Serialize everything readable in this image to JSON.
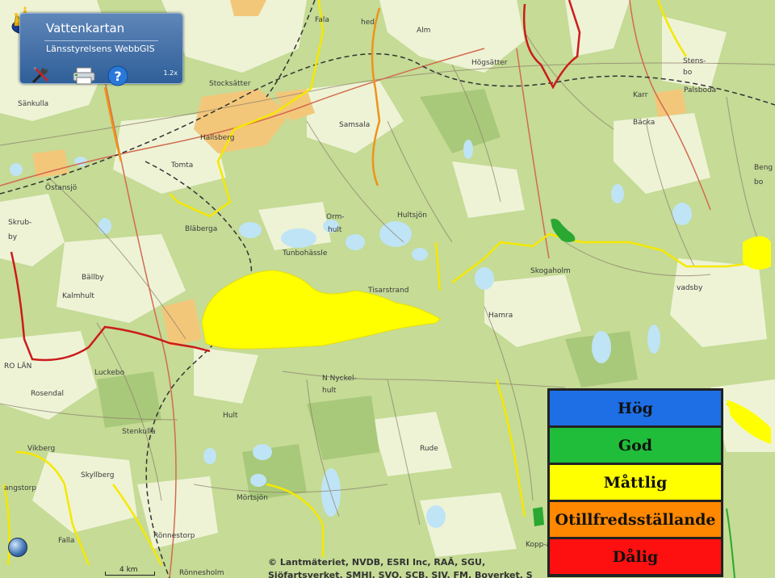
{
  "panel": {
    "title": "Vattenkartan",
    "subtitle": "Länsstyrelsens WebbGIS",
    "version": "1.2x"
  },
  "legend": {
    "items": [
      {
        "label": "Hög",
        "color": "#1e6fe6"
      },
      {
        "label": "God",
        "color": "#1fbd3a"
      },
      {
        "label": "Måttlig",
        "color": "#ffff00"
      },
      {
        "label": "Otillfredsställande",
        "color": "#ff8800"
      },
      {
        "label": "Dålig",
        "color": "#ff1010"
      }
    ]
  },
  "places": [
    "Fala",
    "hed",
    "Alm",
    "Högsätter",
    "Stens-",
    "bo",
    "Palsboda",
    "Stocksätter",
    "Sänkulla",
    "Karr",
    "Bäcka",
    "Samsala",
    "Hallsberg",
    "Tomta",
    "Östansjö",
    "Skrub-",
    "by",
    "Bläberga",
    "Orm-",
    "hult",
    "Hultsjön",
    "Tunbohässle",
    "Skogaholm",
    "vadsby",
    "Tisarstrand",
    "Bällby",
    "Kalmhult",
    "Hamra",
    "RO LÄN",
    "Luckebo",
    "N Nyckel-",
    "hult",
    "Rosendal",
    "Hult",
    "Stenkulla",
    "Vikberg",
    "Rude",
    "Skyllberg",
    "angstorp",
    "Mörtsjön",
    "Falla",
    "Rönnestorp",
    "Rönnesholm",
    "Kopp-a",
    "Beng",
    "bo"
  ],
  "scale": {
    "label": "4 km"
  },
  "copyright": {
    "line1": "© Lantmäteriet, NVDB, ESRI Inc, RAÄ, SGU,",
    "line2": "Sjöfartsverket, SMHI, SVO, SCB, SJV, FM, Boverket, S"
  },
  "icons": {
    "logo": "crown-icon",
    "tools": "tools-icon",
    "print": "print-icon",
    "help": "help-icon",
    "globe": "globe-icon"
  }
}
